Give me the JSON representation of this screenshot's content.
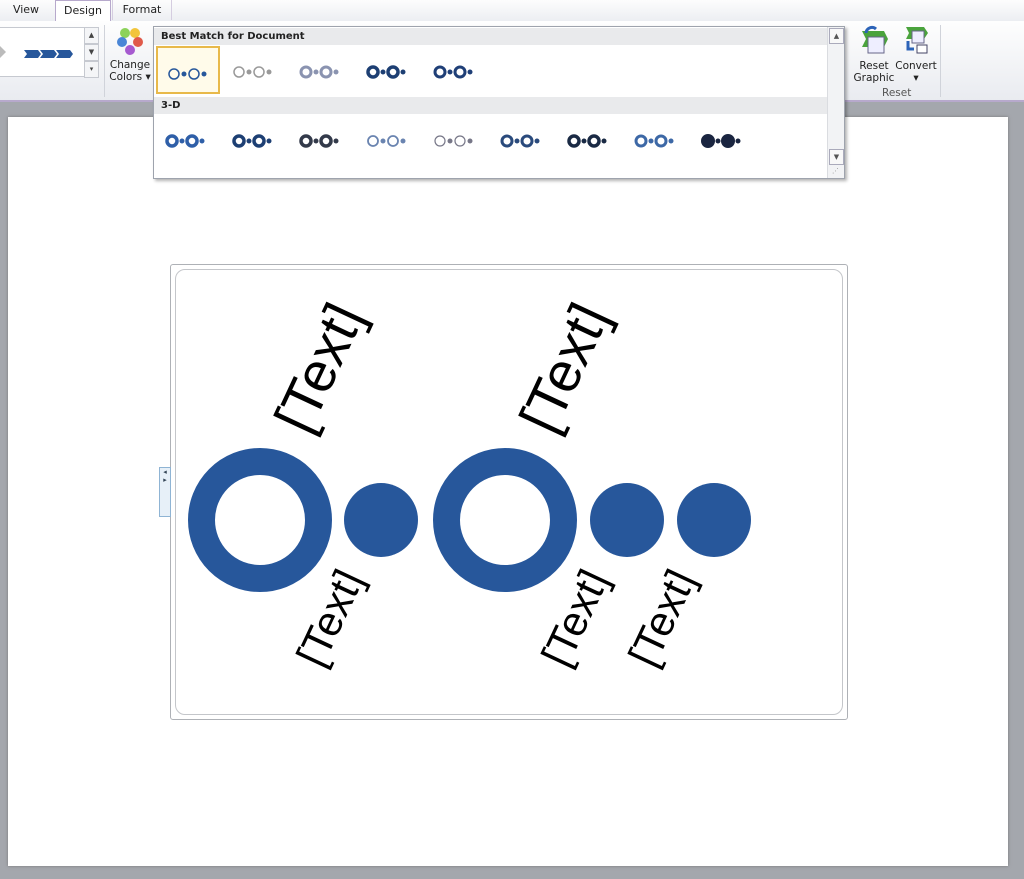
{
  "tabs": [
    {
      "label": "View"
    },
    {
      "label": "Design",
      "active": true
    },
    {
      "label": "Format"
    }
  ],
  "ribbon": {
    "change_colors": {
      "line1": "Change",
      "line2": "Colors ▾"
    },
    "reset_graphic": {
      "line1": "Reset",
      "line2": "Graphic"
    },
    "convert": {
      "line1": "Convert",
      "line2": "▾"
    },
    "reset_group": "Reset"
  },
  "gallery": {
    "sections": [
      {
        "title": "Best Match for Document",
        "items": [
          "simple",
          "outline-light",
          "outline-gray",
          "intense",
          "moderate"
        ],
        "selected": 0
      },
      {
        "title": "3-D",
        "items": [
          "polished",
          "inset",
          "cartoon",
          "powder",
          "brick-scene",
          "sunset",
          "flat-scene",
          "metallic",
          "bird's-eye"
        ]
      }
    ]
  },
  "smartart": {
    "color": "#27579b",
    "shapes": [
      "ring",
      "dot",
      "ring",
      "dot",
      "dot"
    ],
    "texts": [
      "[Text]",
      "[Text]",
      "[Text]",
      "[Text]",
      "[Text]"
    ]
  }
}
